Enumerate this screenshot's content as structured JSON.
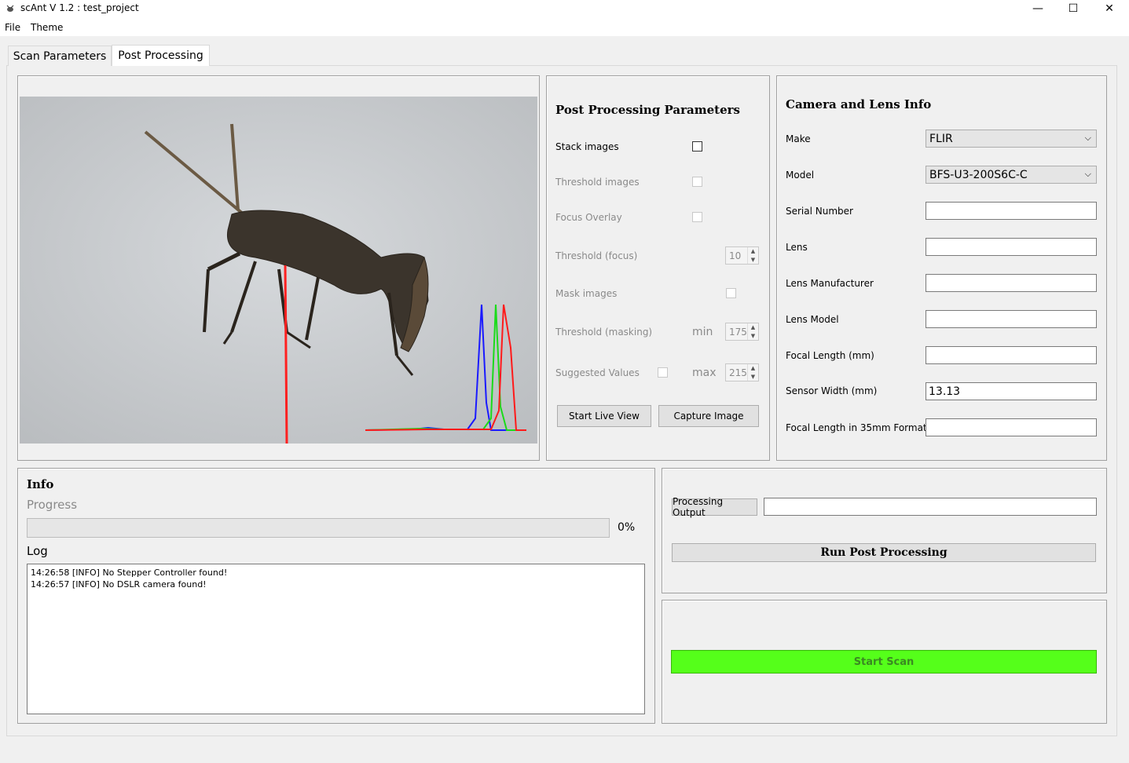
{
  "window": {
    "title": "scAnt V 1.2 :  test_project",
    "controls": {
      "minimize": "—",
      "maximize": "☐",
      "close": "✕"
    }
  },
  "menu": [
    "File",
    "Theme"
  ],
  "tabs": [
    {
      "label": "Scan Parameters",
      "active": false
    },
    {
      "label": "Post Processing",
      "active": true
    }
  ],
  "post_processing": {
    "header": "Post Processing Parameters",
    "stack_images": "Stack images",
    "threshold_images": "Threshold images",
    "focus_overlay": "Focus Overlay",
    "threshold_focus": "Threshold (focus)",
    "threshold_focus_value": "10",
    "mask_images": "Mask images",
    "threshold_masking": "Threshold (masking)",
    "min_label": "min",
    "min_value": "175",
    "suggested_values": "Suggested Values",
    "max_label": "max",
    "max_value": "215",
    "start_live_view": "Start Live View",
    "capture_image": "Capture Image"
  },
  "camera_info": {
    "header": "Camera and Lens Info",
    "make_label": "Make",
    "make_value": "FLIR",
    "model_label": "Model",
    "model_value": "BFS-U3-200S6C-C",
    "serial_label": "Serial Number",
    "serial_value": "",
    "lens_label": "Lens",
    "lens_value": "",
    "lens_manufacturer_label": "Lens Manufacturer",
    "lens_manufacturer_value": "",
    "lens_model_label": "Lens Model",
    "lens_model_value": "",
    "focal_length_label": "Focal Length (mm)",
    "focal_length_value": "",
    "sensor_width_label": "Sensor Width (mm)",
    "sensor_width_value": "13.13",
    "focal_35_label": "Focal Length in 35mm Format",
    "focal_35_value": ""
  },
  "info": {
    "header": "Info",
    "progress_label": "Progress",
    "progress_value": 0,
    "progress_text": "0%",
    "log_label": "Log",
    "log_lines": [
      "14:26:58 [INFO] No Stepper Controller found!",
      "14:26:57 [INFO] No DSLR camera found!"
    ]
  },
  "output": {
    "processing_output_button": "Processing Output",
    "processing_output_value": "",
    "run_post_processing": "Run Post Processing"
  },
  "scan": {
    "start_scan": "Start Scan"
  },
  "colors": {
    "start_scan_bg": "#55ff1a",
    "hist_red": "#ff1a1a",
    "hist_green": "#1adb1a",
    "hist_blue": "#1a1aff"
  }
}
